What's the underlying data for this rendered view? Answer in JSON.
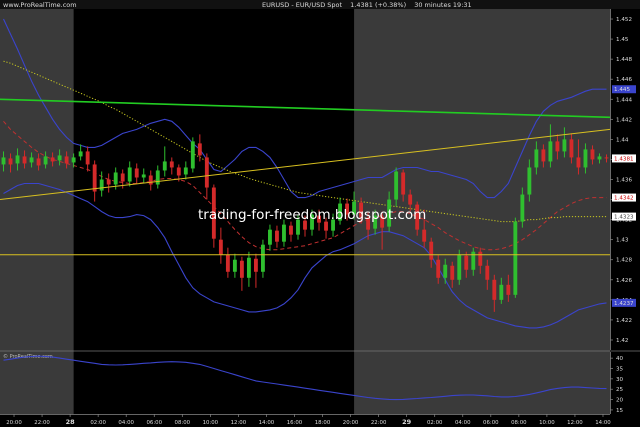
{
  "header": {
    "left": "www.ProRealTime.com",
    "title": "EURUSD - EUR/USD Spot",
    "price_info": "1.4381 (+0.38%)",
    "meta": "30 minutes  19:31"
  },
  "watermark": "trading-for-freedom.blogspot.com",
  "sub_caption": "© ProRealTime.com",
  "colors": {
    "background": "#000000",
    "shaded_session": "#3a3a3a",
    "up_candle": "#2fbf2f",
    "down_candle": "#d42a2a",
    "bollinger": "#3a44cc",
    "dashed_ma": "#c23030",
    "dotted_ma": "#c8c820",
    "green_trendline": "#22cc22",
    "yellow_lines": "#d8c020",
    "text": "#dcdcdc",
    "price_tag_close": "#ffffff"
  },
  "chart_data": {
    "type": "candlestick",
    "timeframe": "30 minutes",
    "instrument": "EURUSD",
    "y_axis": {
      "range": [
        1.419,
        1.453
      ],
      "ticks": [
        "1.452",
        "1.45",
        "1.448",
        "1.446",
        "1.444",
        "1.442",
        "1.44",
        "1.438",
        "1.436",
        "1.434",
        "1.432",
        "1.43",
        "1.428",
        "1.426",
        "1.424",
        "1.422",
        "1.42"
      ]
    },
    "x_ticks": [
      "20:00",
      "22:00",
      "28",
      "02:00",
      "04:00",
      "06:00",
      "08:00",
      "10:00",
      "12:00",
      "14:00",
      "16:00",
      "18:00",
      "20:00",
      "22:00",
      "29",
      "02:00",
      "04:00",
      "06:00",
      "08:00",
      "10:00",
      "12:00",
      "14:00",
      "16:00",
      "18:00",
      "20:00"
    ],
    "bar_index_of_first_tick": 2,
    "bars_per_tick": 4,
    "shaded_regions_bar_ranges": [
      [
        0,
        10.5
      ],
      [
        50.5,
        87
      ]
    ],
    "price_tags": [
      {
        "label": "1.445",
        "value": 1.445
      },
      {
        "label": "1.4381",
        "value": 1.4381
      },
      {
        "label": "1.4342",
        "value": 1.4342
      },
      {
        "label": "1.4323",
        "value": 1.4323
      },
      {
        "label": "1.4237",
        "value": 1.4237
      }
    ],
    "candles": [
      [
        1.4375,
        1.4382,
        1.4388,
        1.4368
      ],
      [
        1.4381,
        1.4375,
        1.4386,
        1.4367
      ],
      [
        1.4376,
        1.4384,
        1.4391,
        1.4369
      ],
      [
        1.4383,
        1.4376,
        1.4389,
        1.4371
      ],
      [
        1.4377,
        1.4382,
        1.4387,
        1.4372
      ],
      [
        1.4381,
        1.4374,
        1.4386,
        1.4369
      ],
      [
        1.4375,
        1.4383,
        1.4388,
        1.4371
      ],
      [
        1.4382,
        1.4378,
        1.4387,
        1.4373
      ],
      [
        1.4379,
        1.4384,
        1.439,
        1.4374
      ],
      [
        1.4383,
        1.4376,
        1.4388,
        1.4371
      ],
      [
        1.4377,
        1.4382,
        1.4386,
        1.4372
      ],
      [
        1.4383,
        1.4388,
        1.4395,
        1.4379
      ],
      [
        1.4388,
        1.4375,
        1.4393,
        1.4368
      ],
      [
        1.4375,
        1.4348,
        1.4379,
        1.4338
      ],
      [
        1.4349,
        1.436,
        1.4368,
        1.4343
      ],
      [
        1.436,
        1.4355,
        1.4366,
        1.4347
      ],
      [
        1.4355,
        1.4367,
        1.4372,
        1.435
      ],
      [
        1.4366,
        1.4358,
        1.437,
        1.4351
      ],
      [
        1.4358,
        1.4372,
        1.4378,
        1.4353
      ],
      [
        1.4371,
        1.4362,
        1.4376,
        1.4356
      ],
      [
        1.4362,
        1.4365,
        1.4371,
        1.4356
      ],
      [
        1.4364,
        1.4355,
        1.4369,
        1.4349
      ],
      [
        1.4355,
        1.4369,
        1.4374,
        1.4351
      ],
      [
        1.4369,
        1.4378,
        1.4393,
        1.4363
      ],
      [
        1.4378,
        1.4372,
        1.4382,
        1.4365
      ],
      [
        1.4372,
        1.4364,
        1.4375,
        1.4358
      ],
      [
        1.4365,
        1.4372,
        1.4378,
        1.436
      ],
      [
        1.4371,
        1.4398,
        1.4402,
        1.4367
      ],
      [
        1.4396,
        1.4384,
        1.4405,
        1.4378
      ],
      [
        1.4382,
        1.4352,
        1.4386,
        1.434
      ],
      [
        1.4352,
        1.4301,
        1.4355,
        1.4292
      ],
      [
        1.43,
        1.4285,
        1.4312,
        1.4276
      ],
      [
        1.4285,
        1.4268,
        1.4292,
        1.4262
      ],
      [
        1.4268,
        1.428,
        1.4286,
        1.4262
      ],
      [
        1.4279,
        1.4262,
        1.4283,
        1.4249
      ],
      [
        1.4262,
        1.4282,
        1.4288,
        1.4253
      ],
      [
        1.4281,
        1.4268,
        1.4286,
        1.4252
      ],
      [
        1.4268,
        1.4295,
        1.43,
        1.4262
      ],
      [
        1.4295,
        1.431,
        1.4315,
        1.4289
      ],
      [
        1.4309,
        1.4298,
        1.4314,
        1.4292
      ],
      [
        1.4298,
        1.4315,
        1.432,
        1.4293
      ],
      [
        1.4314,
        1.4305,
        1.4318,
        1.4298
      ],
      [
        1.4305,
        1.432,
        1.4325,
        1.43
      ],
      [
        1.4319,
        1.431,
        1.4324,
        1.4303
      ],
      [
        1.431,
        1.4325,
        1.433,
        1.4304
      ],
      [
        1.4324,
        1.4317,
        1.433,
        1.4309
      ],
      [
        1.4318,
        1.4309,
        1.4322,
        1.4301
      ],
      [
        1.4309,
        1.432,
        1.4326,
        1.4303
      ],
      [
        1.4319,
        1.4336,
        1.4342,
        1.4315
      ],
      [
        1.4336,
        1.4325,
        1.4341,
        1.4319
      ],
      [
        1.4325,
        1.4338,
        1.4348,
        1.432
      ],
      [
        1.4337,
        1.4322,
        1.4342,
        1.4316
      ],
      [
        1.4322,
        1.431,
        1.4327,
        1.43
      ],
      [
        1.4311,
        1.4324,
        1.433,
        1.4305
      ],
      [
        1.4323,
        1.4312,
        1.4328,
        1.429
      ],
      [
        1.4313,
        1.434,
        1.4348,
        1.4308
      ],
      [
        1.434,
        1.4368,
        1.4372,
        1.4333
      ],
      [
        1.4367,
        1.4345,
        1.437,
        1.4338
      ],
      [
        1.4345,
        1.4335,
        1.435,
        1.4328
      ],
      [
        1.4335,
        1.431,
        1.4338,
        1.4304
      ],
      [
        1.431,
        1.4298,
        1.433,
        1.4292
      ],
      [
        1.4298,
        1.428,
        1.4302,
        1.4272
      ],
      [
        1.428,
        1.4262,
        1.4285,
        1.4256
      ],
      [
        1.4262,
        1.4275,
        1.4281,
        1.4256
      ],
      [
        1.4274,
        1.426,
        1.4278,
        1.4252
      ],
      [
        1.426,
        1.4285,
        1.429,
        1.4255
      ],
      [
        1.4284,
        1.427,
        1.4288,
        1.4262
      ],
      [
        1.427,
        1.4288,
        1.4292,
        1.4264
      ],
      [
        1.4288,
        1.4274,
        1.4292,
        1.4266
      ],
      [
        1.4274,
        1.426,
        1.428,
        1.425
      ],
      [
        1.426,
        1.424,
        1.4265,
        1.4228
      ],
      [
        1.424,
        1.4255,
        1.4262,
        1.4236
      ],
      [
        1.4255,
        1.4245,
        1.4265,
        1.4238
      ],
      [
        1.4245,
        1.4318,
        1.4322,
        1.4242
      ],
      [
        1.4318,
        1.4345,
        1.4352,
        1.4312
      ],
      [
        1.4345,
        1.4372,
        1.438,
        1.4338
      ],
      [
        1.4372,
        1.439,
        1.4398,
        1.4365
      ],
      [
        1.439,
        1.4378,
        1.4395,
        1.4372
      ],
      [
        1.4378,
        1.4398,
        1.4415,
        1.4372
      ],
      [
        1.4398,
        1.4388,
        1.4405,
        1.438
      ],
      [
        1.4388,
        1.44,
        1.4412,
        1.4382
      ],
      [
        1.44,
        1.4382,
        1.4406,
        1.4376
      ],
      [
        1.4382,
        1.4372,
        1.44,
        1.4365
      ],
      [
        1.4372,
        1.439,
        1.4396,
        1.4366
      ],
      [
        1.439,
        1.438,
        1.4394,
        1.4375
      ],
      [
        1.438,
        1.4383,
        1.4386,
        1.4376
      ],
      [
        1.4382,
        1.4381,
        1.4385,
        1.4377
      ]
    ],
    "bollinger_upper": [
      1.452,
      1.4505,
      1.449,
      1.4474,
      1.4458,
      1.4444,
      1.4432,
      1.442,
      1.441,
      1.4402,
      1.4396,
      1.4394,
      1.4392,
      1.4392,
      1.4394,
      1.4398,
      1.4402,
      1.4406,
      1.4408,
      1.441,
      1.4413,
      1.4416,
      1.4418,
      1.442,
      1.4418,
      1.4412,
      1.4404,
      1.4396,
      1.439,
      1.438,
      1.437,
      1.4368,
      1.4374,
      1.438,
      1.4388,
      1.4392,
      1.4392,
      1.4388,
      1.4382,
      1.4372,
      1.436,
      1.4348,
      1.4342,
      1.4342,
      1.4344,
      1.4348,
      1.435,
      1.4352,
      1.4354,
      1.4356,
      1.4358,
      1.436,
      1.4362,
      1.4362,
      1.4362,
      1.4366,
      1.437,
      1.4372,
      1.4372,
      1.4372,
      1.437,
      1.4368,
      1.4368,
      1.4366,
      1.4364,
      1.4362,
      1.436,
      1.4356,
      1.4348,
      1.4342,
      1.4342,
      1.4348,
      1.4356,
      1.4372,
      1.4388,
      1.4404,
      1.4418,
      1.4428,
      1.4434,
      1.4438,
      1.444,
      1.4442,
      1.4445,
      1.4448,
      1.445,
      1.445,
      1.445
    ],
    "bollinger_lower": [
      1.4346,
      1.435,
      1.4354,
      1.4356,
      1.4356,
      1.4356,
      1.4354,
      1.4352,
      1.435,
      1.4347,
      1.4344,
      1.4341,
      1.4338,
      1.4333,
      1.4328,
      1.4324,
      1.4322,
      1.4322,
      1.4323,
      1.4325,
      1.4324,
      1.432,
      1.4312,
      1.4302,
      1.4288,
      1.4275,
      1.4262,
      1.4252,
      1.4246,
      1.4242,
      1.4238,
      1.4236,
      1.4234,
      1.4232,
      1.423,
      1.4228,
      1.4228,
      1.4229,
      1.423,
      1.4232,
      1.4236,
      1.4242,
      1.425,
      1.4262,
      1.4272,
      1.4278,
      1.4284,
      1.4288,
      1.429,
      1.4293,
      1.4296,
      1.43,
      1.4304,
      1.4306,
      1.4308,
      1.4308,
      1.4306,
      1.4304,
      1.43,
      1.4296,
      1.4292,
      1.4284,
      1.4272,
      1.426,
      1.4248,
      1.424,
      1.4234,
      1.423,
      1.4226,
      1.4222,
      1.422,
      1.4218,
      1.4216,
      1.4214,
      1.4213,
      1.4212,
      1.4212,
      1.4213,
      1.4215,
      1.4218,
      1.4222,
      1.4226,
      1.423,
      1.4232,
      1.4234,
      1.4236,
      1.4237
    ],
    "dashed_ma": [
      1.4418,
      1.441,
      1.4404,
      1.4398,
      1.4392,
      1.4387,
      1.4383,
      1.438,
      1.4378,
      1.4376,
      1.4374,
      1.4372,
      1.437,
      1.4367,
      1.4363,
      1.436,
      1.4358,
      1.4357,
      1.4356,
      1.4356,
      1.4357,
      1.4358,
      1.436,
      1.4361,
      1.4361,
      1.436,
      1.4358,
      1.4354,
      1.4347,
      1.434,
      1.4333,
      1.4326,
      1.4318,
      1.431,
      1.4303,
      1.4297,
      1.4293,
      1.4291,
      1.429,
      1.429,
      1.4291,
      1.4292,
      1.4293,
      1.4294,
      1.4296,
      1.4298,
      1.43,
      1.4302,
      1.4306,
      1.431,
      1.4314,
      1.4318,
      1.432,
      1.4322,
      1.4324,
      1.4326,
      1.4328,
      1.4328,
      1.4326,
      1.4323,
      1.432,
      1.4316,
      1.4312,
      1.4307,
      1.4303,
      1.4299,
      1.4296,
      1.4293,
      1.4291,
      1.429,
      1.429,
      1.4291,
      1.4293,
      1.4296,
      1.43,
      1.4305,
      1.431,
      1.4316,
      1.4322,
      1.4328,
      1.4332,
      1.4336,
      1.4339,
      1.4341,
      1.4342,
      1.4342,
      1.4342
    ],
    "dotted_ma": [
      1.4478,
      1.4476,
      1.4473,
      1.447,
      1.4467,
      1.4464,
      1.4461,
      1.4458,
      1.4455,
      1.4452,
      1.4449,
      1.4446,
      1.4443,
      1.444,
      1.4437,
      1.4433,
      1.443,
      1.4426,
      1.4422,
      1.4418,
      1.4414,
      1.441,
      1.4406,
      1.4402,
      1.4398,
      1.4394,
      1.439,
      1.4386,
      1.4382,
      1.4378,
      1.4375,
      1.4372,
      1.4369,
      1.4366,
      1.4364,
      1.4361,
      1.4359,
      1.4357,
      1.4355,
      1.4353,
      1.4351,
      1.4349,
      1.4347,
      1.4346,
      1.4345,
      1.4344,
      1.4343,
      1.4342,
      1.4341,
      1.434,
      1.4339,
      1.4338,
      1.4337,
      1.4336,
      1.4335,
      1.4334,
      1.4333,
      1.4332,
      1.4331,
      1.433,
      1.4329,
      1.4328,
      1.4327,
      1.4326,
      1.4325,
      1.4324,
      1.4323,
      1.4322,
      1.4321,
      1.432,
      1.4319,
      1.4318,
      1.4318,
      1.4318,
      1.4319,
      1.432,
      1.432,
      1.4321,
      1.4322,
      1.4322,
      1.4323,
      1.4323,
      1.4323,
      1.4323,
      1.4323,
      1.4323,
      1.4323
    ],
    "green_trendline": {
      "from": [
        0,
        1.444
      ],
      "to": [
        87,
        1.4422
      ]
    },
    "yellow_trendline": {
      "from": [
        0,
        1.434
      ],
      "to": [
        87,
        1.441
      ]
    },
    "horizontal_level": 1.4285,
    "sub_panel": {
      "type": "line",
      "range": [
        14,
        42
      ],
      "ticks": [
        "40",
        "35",
        "30",
        "25",
        "20",
        "15"
      ],
      "values": [
        39,
        39.5,
        40,
        40.5,
        40.8,
        41,
        40.8,
        40.5,
        40,
        39.5,
        39,
        38.5,
        38,
        37.5,
        37,
        36.8,
        36.7,
        36.8,
        37,
        37.2,
        37.5,
        37.7,
        38,
        38.2,
        38.3,
        38.2,
        38,
        37.5,
        37,
        36,
        35,
        34,
        33,
        32,
        31,
        30,
        29,
        28.5,
        28,
        27.5,
        27,
        26.5,
        26,
        25.5,
        25,
        24.5,
        24,
        23.5,
        23,
        22.5,
        22,
        21.5,
        21,
        20.6,
        20.3,
        20.1,
        20,
        20.1,
        20.3,
        20.5,
        20.8,
        21,
        21.3,
        21.6,
        21.9,
        22.1,
        22.2,
        22.2,
        22,
        21.8,
        21.5,
        21.3,
        21.3,
        21.5,
        21.9,
        22.5,
        23.2,
        24,
        24.8,
        25.4,
        25.8,
        26,
        26,
        25.8,
        25.6,
        25.4,
        25.3
      ]
    }
  }
}
